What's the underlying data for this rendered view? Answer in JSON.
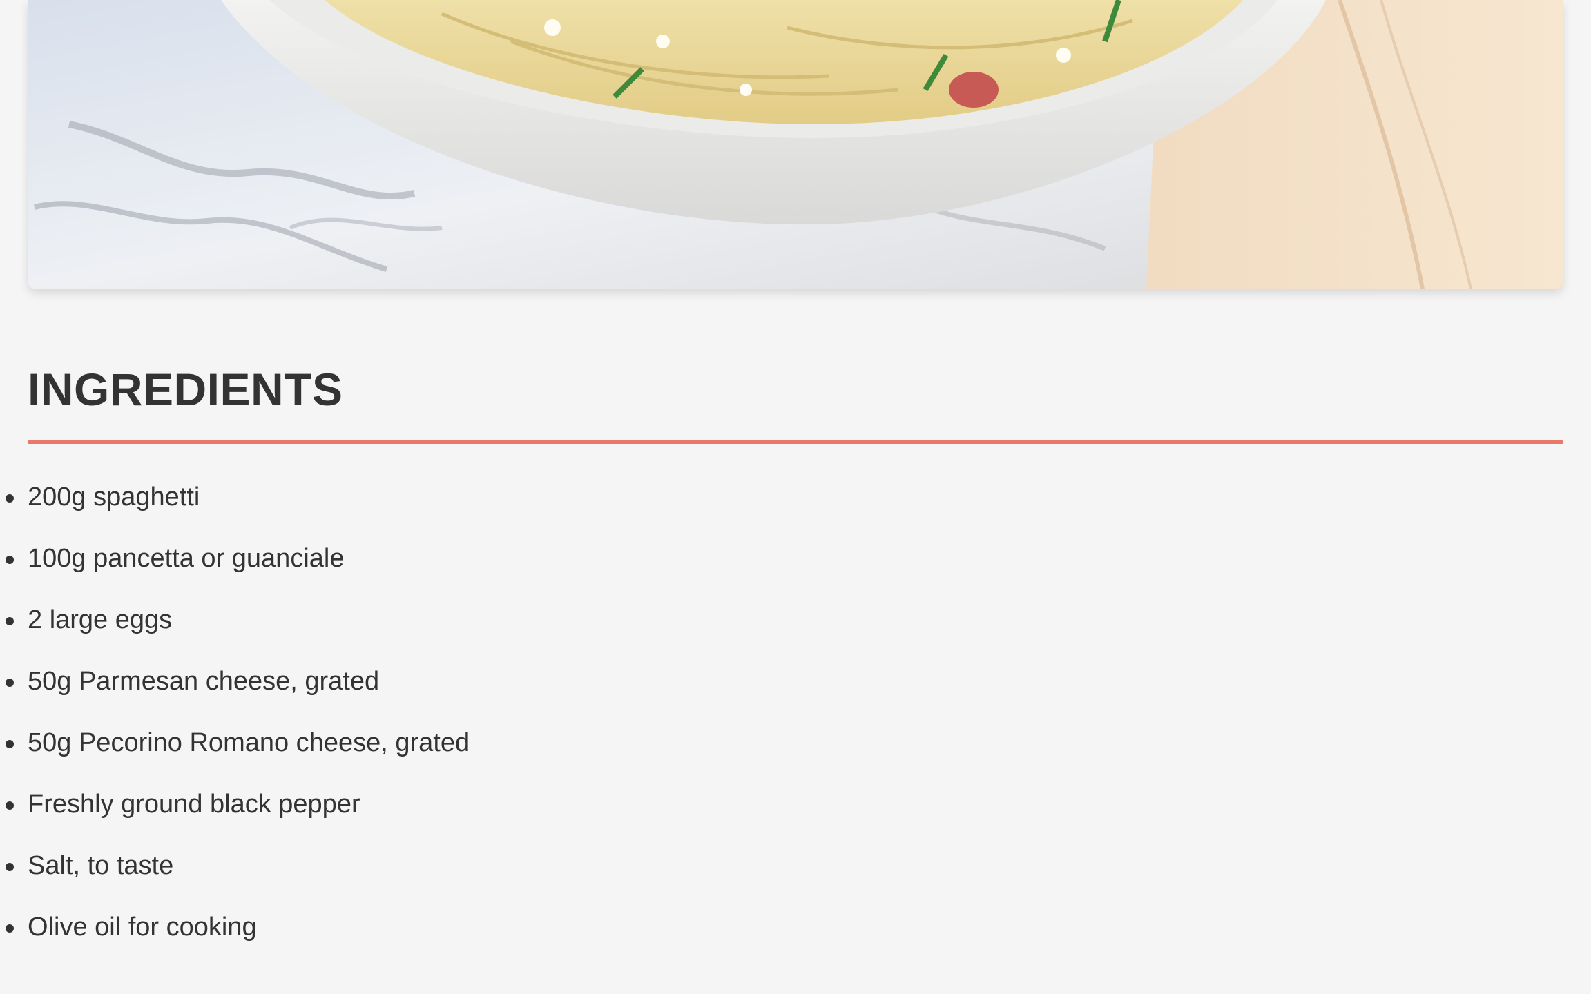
{
  "hero_image": {
    "icon": "pasta-carbonara-photo",
    "alt": ""
  },
  "ingredients_section": {
    "title": "INGREDIENTS",
    "accent_color": "#e8786a",
    "items": [
      "200g spaghetti",
      "100g pancetta or guanciale",
      "2 large eggs",
      "50g Parmesan cheese, grated",
      "50g Pecorino Romano cheese, grated",
      "Freshly ground black pepper",
      "Salt, to taste",
      "Olive oil for cooking"
    ]
  }
}
